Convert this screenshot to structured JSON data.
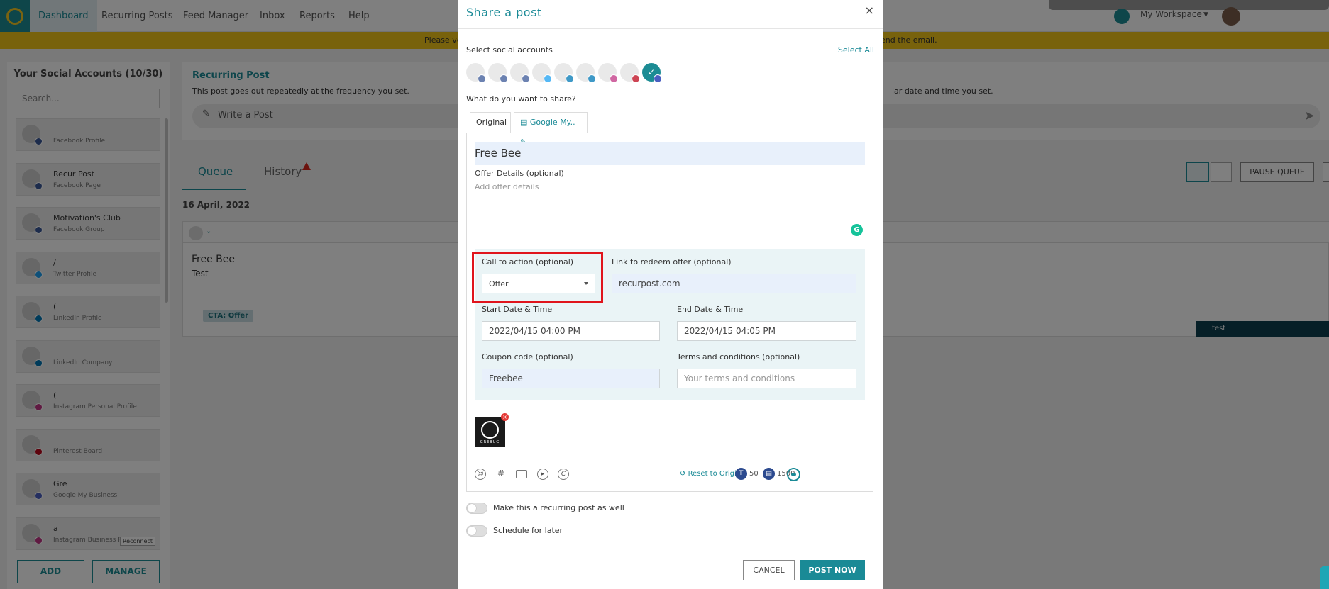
{
  "nav": {
    "tabs": [
      "Dashboard",
      "Recurring Posts",
      "Feed Manager",
      "Inbox",
      "Reports",
      "Help"
    ],
    "workspace": "My Workspace"
  },
  "notice": {
    "left": "Please ve",
    "right": "end the email."
  },
  "sidebar": {
    "title": "Your Social Accounts (10/30)",
    "search_placeholder": "Search...",
    "accounts": [
      {
        "name": "",
        "type": "Facebook Profile",
        "badge_color": "#3b5998"
      },
      {
        "name": "Recur Post",
        "type": "Facebook Page",
        "badge_color": "#3b5998"
      },
      {
        "name": "Motivation's Club",
        "type": "Facebook Group",
        "badge_color": "#3b5998"
      },
      {
        "name": "/",
        "type": "Twitter Profile",
        "badge_color": "#1da1f2"
      },
      {
        "name": "(",
        "type": "LinkedIn Profile",
        "badge_color": "#0077b5"
      },
      {
        "name": "",
        "type": "LinkedIn Company",
        "badge_color": "#0077b5"
      },
      {
        "name": "(",
        "type": "Instagram Personal Profile",
        "badge_color": "#c13584"
      },
      {
        "name": "",
        "type": "Pinterest Board",
        "badge_color": "#bd081c"
      },
      {
        "name": "Gre",
        "type": "Google My Business",
        "badge_color": "#4a5fc1"
      },
      {
        "name": "a",
        "type": "Instagram Business Pr...",
        "badge_color": "#c13584",
        "reconnect": "Reconnect"
      }
    ],
    "add_label": "ADD",
    "manage_label": "MANAGE"
  },
  "main": {
    "recurring_title": "Recurring Post",
    "recurring_desc": "This post goes out repeatedly at the frequency you set.",
    "recurring_desc_right": "lar date and time you set.",
    "write_placeholder": "Write a Post",
    "tab_queue": "Queue",
    "tab_history": "History",
    "date": "16 April, 2022",
    "pause_label": "PAUSE QUEUE",
    "post": {
      "title": "Free Bee",
      "body": "Test",
      "cta": "CTA: Offer",
      "tag": "test"
    }
  },
  "modal": {
    "title": "Share a post",
    "close": "×",
    "select_accounts_label": "Select social accounts",
    "select_all": "Select All",
    "accounts": [
      {
        "badge_color": "#3b5998"
      },
      {
        "badge_color": "#3b5998"
      },
      {
        "badge_color": "#3b5998"
      },
      {
        "badge_color": "#1da1f2"
      },
      {
        "badge_color": "#0077b5"
      },
      {
        "badge_color": "#0077b5"
      },
      {
        "badge_color": "#c13584"
      },
      {
        "badge_color": "#bd081c"
      },
      {
        "badge_color": "#4a5fc1",
        "selected": true
      }
    ],
    "share_question": "What do you want to share?",
    "tab_original": "Original",
    "tab_gmb": "Google My..",
    "title_value": "Free Bee",
    "offer_details_label": "Offer Details (optional)",
    "offer_details_placeholder": "Add offer details",
    "cta_label": "Call to action (optional)",
    "cta_value": "Offer",
    "link_label": "Link to redeem offer (optional)",
    "link_value": "recurpost.com",
    "start_label": "Start Date & Time",
    "start_value": "2022/04/15 04:00 PM",
    "end_label": "End Date & Time",
    "end_value": "2022/04/15 04:05 PM",
    "coupon_label": "Coupon code (optional)",
    "coupon_value": "Freebee",
    "terms_label": "Terms and conditions (optional)",
    "terms_placeholder": "Your terms and conditions",
    "thumb_caption": "GREBUG",
    "reset_label": "Reset to Original",
    "count_t": "50",
    "count_g": "1500",
    "recurring_toggle_label": "Make this a recurring post as well",
    "schedule_toggle_label": "Schedule for later",
    "cancel_label": "CANCEL",
    "post_now_label": "POST NOW",
    "accent_color": "#1a8a96"
  }
}
